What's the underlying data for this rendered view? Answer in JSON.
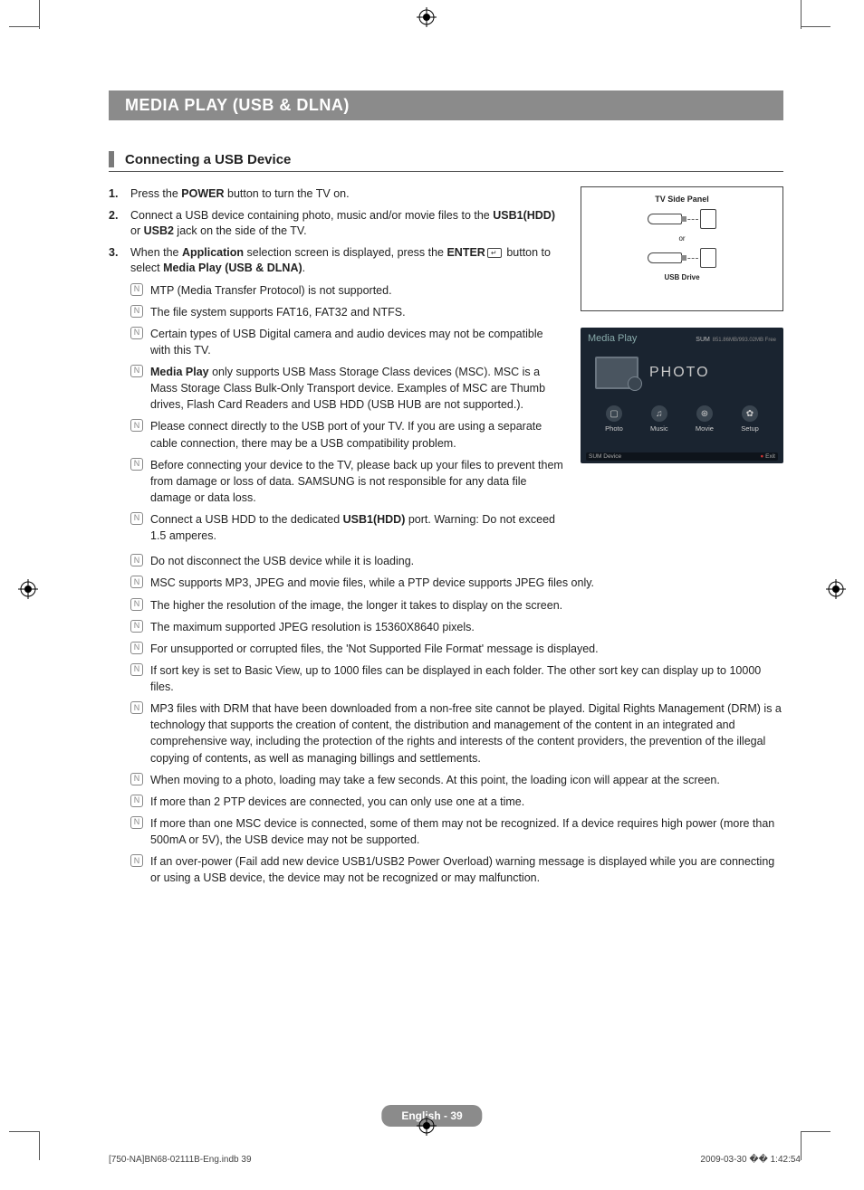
{
  "title_bar": "MEDIA PLAY (USB & DLNA)",
  "section_title": "Connecting a USB Device",
  "steps": {
    "s1_pre": "Press the ",
    "s1_b1": "POWER",
    "s1_post": " button to turn the TV on.",
    "s2_pre": "Connect a USB device containing photo, music and/or movie files to the ",
    "s2_b1": "USB1(HDD)",
    "s2_mid": " or ",
    "s2_b2": "USB2",
    "s2_post": " jack on the side of the TV.",
    "s3_pre": "When the ",
    "s3_b1": "Application",
    "s3_mid1": " selection screen is displayed, press the ",
    "s3_b2": "ENTER",
    "s3_mid2": " button to select ",
    "s3_b3": "Media Play (USB & DLNA)",
    "s3_post": "."
  },
  "notes_top": [
    "MTP (Media Transfer Protocol) is not supported.",
    "The file system supports FAT16, FAT32 and NTFS.",
    "Certain types of USB Digital camera and audio devices may not be compatible with this TV."
  ],
  "note_mediaplay_b": "Media Play",
  "note_mediaplay_rest": " only supports USB Mass Storage Class devices (MSC). MSC is a Mass Storage Class Bulk-Only Transport device. Examples of MSC are Thumb drives, Flash Card Readers and USB HDD (USB HUB are not supported.).",
  "notes_mid": [
    "Please connect directly to the USB port of your TV. If you are using a separate cable connection, there may be a USB compatibility problem.",
    "Before connecting your device to the TV, please back up your files to prevent them from damage or loss of data. SAMSUNG is not responsible for any data file damage or data loss."
  ],
  "note_hdd_pre": "Connect a USB HDD to the dedicated ",
  "note_hdd_b": "USB1(HDD)",
  "note_hdd_post": " port. Warning: Do not exceed 1.5 amperes.",
  "notes_full": [
    "Do not disconnect the USB device while it is loading.",
    "MSC supports MP3, JPEG and movie files, while a PTP device supports JPEG files only.",
    "The higher the resolution of the image, the longer it takes to display on the screen.",
    "The maximum supported JPEG resolution is 15360X8640 pixels.",
    "For unsupported or corrupted files, the 'Not Supported File Format' message is displayed.",
    "If sort key is set to Basic View, up to 1000 files can be displayed in each folder. The other sort key can display up to 10000 files.",
    "MP3 files with DRM that have been downloaded from a non-free site cannot be played. Digital Rights Management (DRM) is a technology that supports the creation of content, the distribution and management of the content in an integrated and comprehensive way, including the protection of the rights and interests of the content providers, the prevention of the illegal copying of contents, as well as managing billings and settlements.",
    "When moving to a photo, loading may take a few seconds. At this point, the loading icon will appear at the screen.",
    "If more than 2 PTP devices are connected, you can only use one at a time.",
    "If more than one MSC device is connected, some of them may not be recognized. If a device requires high power (more than 500mA or 5V), the USB device may not be supported.",
    "If an over-power (Fail add new device USB1/USB2 Power Overload) warning message is displayed while you are connecting or using a USB device, the device may not be recognized or may malfunction."
  ],
  "diagram": {
    "panel": "TV Side Panel",
    "or": "or",
    "drive": "USB Drive"
  },
  "screen": {
    "title": "Media Play",
    "sum": "SUM",
    "free": "851.86MB/993.02MB Free",
    "photo": "PHOTO",
    "items": [
      "Photo",
      "Music",
      "Movie",
      "Setup"
    ],
    "footer_left": "SUM    Device",
    "footer_right": "Exit"
  },
  "page_footer": "English - 39",
  "doc_footer_left": "[750-NA]BN68-02111B-Eng.indb   39",
  "doc_footer_right": "2009-03-30   �� 1:42:54"
}
